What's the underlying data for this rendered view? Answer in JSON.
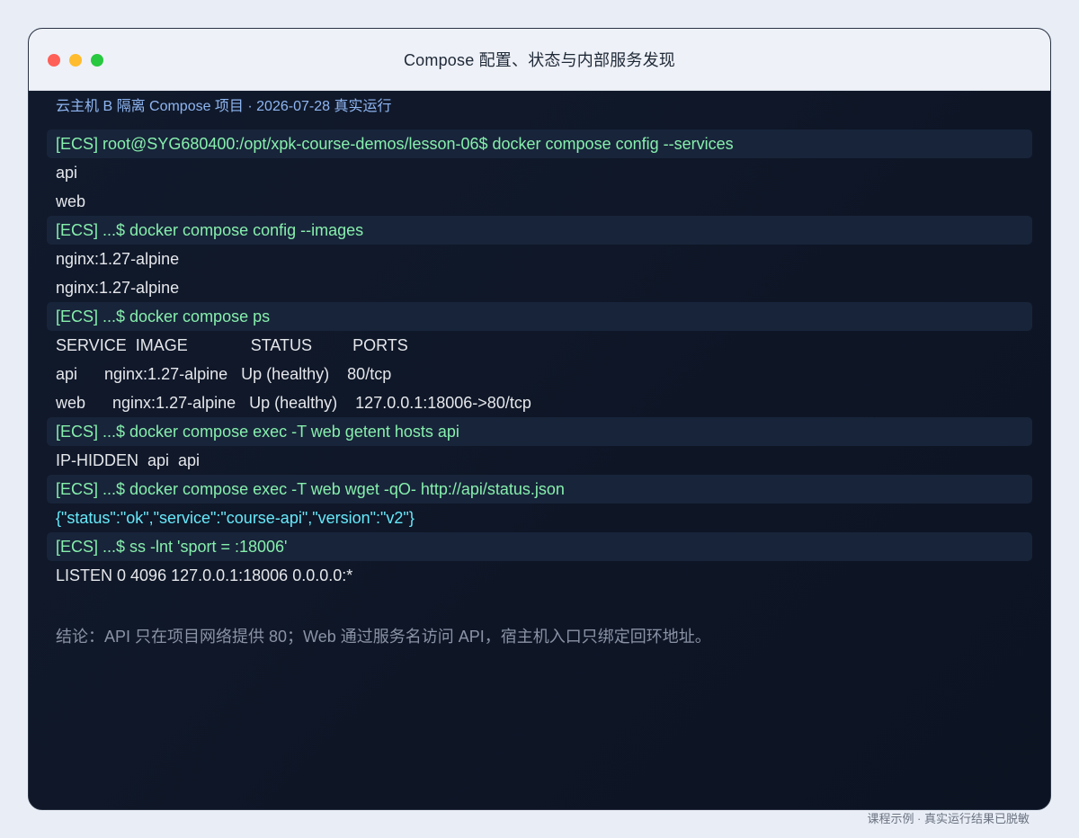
{
  "window": {
    "title": "Compose 配置、状态与内部服务发现"
  },
  "terminal": {
    "caption": "云主机 B 隔离 Compose 项目 · 2026-07-28 真实运行",
    "lines": [
      {
        "type": "cmd",
        "text": "[ECS] root@SYG680400:/opt/xpk-course-demos/lesson-06$ docker compose config --services"
      },
      {
        "type": "out",
        "text": "api"
      },
      {
        "type": "out",
        "text": "web"
      },
      {
        "type": "cmd",
        "text": "[ECS] ...$ docker compose config --images"
      },
      {
        "type": "out",
        "text": "nginx:1.27-alpine"
      },
      {
        "type": "out",
        "text": "nginx:1.27-alpine"
      },
      {
        "type": "cmd",
        "text": "[ECS] ...$ docker compose ps"
      },
      {
        "type": "out",
        "text": "SERVICE  IMAGE              STATUS         PORTS"
      },
      {
        "type": "out",
        "text": "api      nginx:1.27-alpine   Up (healthy)    80/tcp"
      },
      {
        "type": "out",
        "text": "web      nginx:1.27-alpine   Up (healthy)    127.0.0.1:18006->80/tcp"
      },
      {
        "type": "cmd",
        "text": "[ECS] ...$ docker compose exec -T web getent hosts api"
      },
      {
        "type": "out",
        "text": "IP-HIDDEN  api  api"
      },
      {
        "type": "cmd",
        "text": "[ECS] ...$ docker compose exec -T web wget -qO- http://api/status.json"
      },
      {
        "type": "json",
        "text": "{\"status\":\"ok\",\"service\":\"course-api\",\"version\":\"v2\"}"
      },
      {
        "type": "cmd",
        "text": "[ECS] ...$ ss -lnt 'sport = :18006'"
      },
      {
        "type": "out",
        "text": "LISTEN 0 4096 127.0.0.1:18006 0.0.0.0:*"
      }
    ],
    "conclusion": "结论：API 只在项目网络提供 80；Web 通过服务名访问 API，宿主机入口只绑定回环地址。"
  },
  "footer": "课程示例 · 真实运行结果已脱敏",
  "colors": {
    "command_green": "#86efac",
    "json_cyan": "#67e8f9",
    "caption_blue": "#8fb6f2",
    "terminal_bg": "#0e1525"
  }
}
